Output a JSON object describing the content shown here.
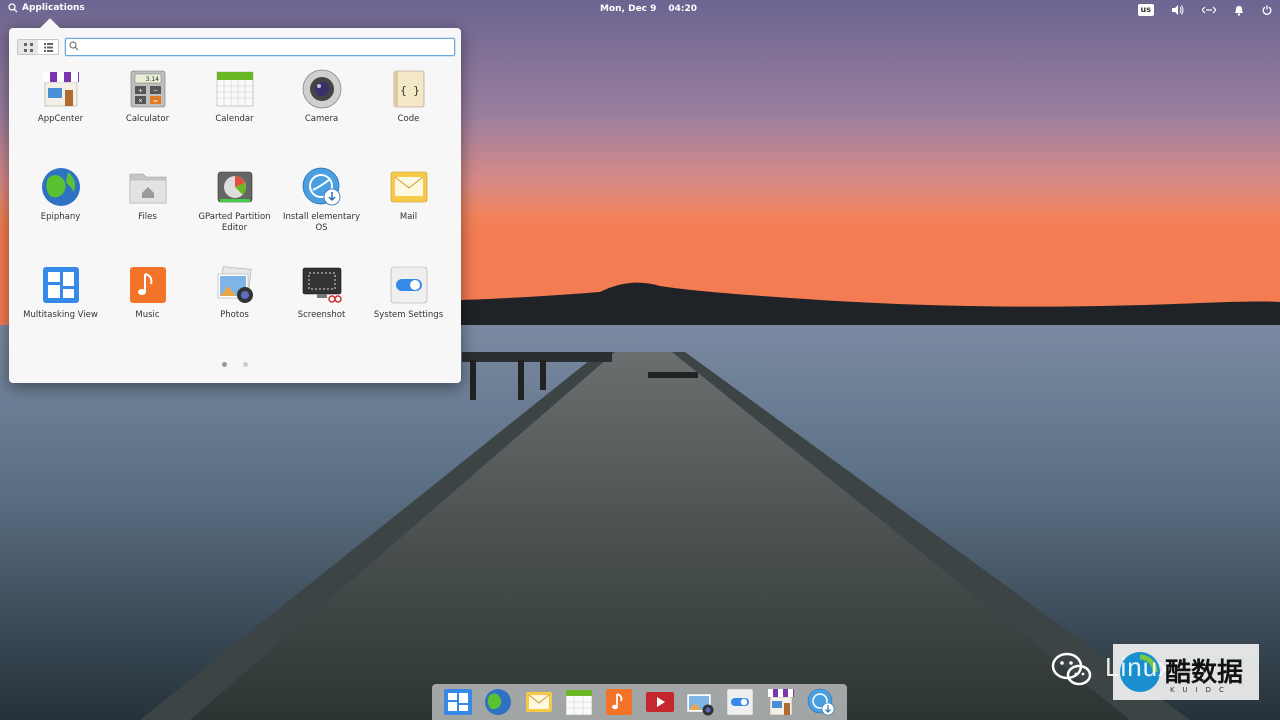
{
  "top_panel": {
    "applications_label": "Applications",
    "date": "Mon, Dec 9",
    "time": "04:20",
    "keyboard_layout": "us"
  },
  "launcher": {
    "search": {
      "value": "",
      "placeholder": ""
    },
    "apps": [
      {
        "label": "AppCenter",
        "icon": "appcenter-icon"
      },
      {
        "label": "Calculator",
        "icon": "calculator-icon"
      },
      {
        "label": "Calendar",
        "icon": "calendar-icon"
      },
      {
        "label": "Camera",
        "icon": "camera-icon"
      },
      {
        "label": "Code",
        "icon": "code-icon"
      },
      {
        "label": "Epiphany",
        "icon": "epiphany-icon"
      },
      {
        "label": "Files",
        "icon": "files-icon"
      },
      {
        "label": "GParted Partition Editor",
        "icon": "gparted-icon"
      },
      {
        "label": "Install elementary OS",
        "icon": "installer-icon"
      },
      {
        "label": "Mail",
        "icon": "mail-icon"
      },
      {
        "label": "Multitasking View",
        "icon": "multitasking-icon"
      },
      {
        "label": "Music",
        "icon": "music-icon"
      },
      {
        "label": "Photos",
        "icon": "photos-icon"
      },
      {
        "label": "Screenshot",
        "icon": "screenshot-icon"
      },
      {
        "label": "System Settings",
        "icon": "settings-icon"
      }
    ],
    "calculator_display": "3.14",
    "pages": 2,
    "current_page": 1
  },
  "dock": {
    "items": [
      "multitasking-icon",
      "epiphany-icon",
      "mail-icon",
      "calendar-icon",
      "music-icon",
      "videos-icon",
      "photos-icon",
      "settings-icon",
      "appcenter-icon",
      "installer-icon"
    ]
  },
  "watermark": {
    "latin": "Linux",
    "chinese": "酷数据",
    "subtitle": "KUIDC"
  },
  "colors": {
    "accent": "#3689e6",
    "sky_top": "#6f6a93",
    "sunset": "#f07a52",
    "water": "#5c6f82"
  }
}
